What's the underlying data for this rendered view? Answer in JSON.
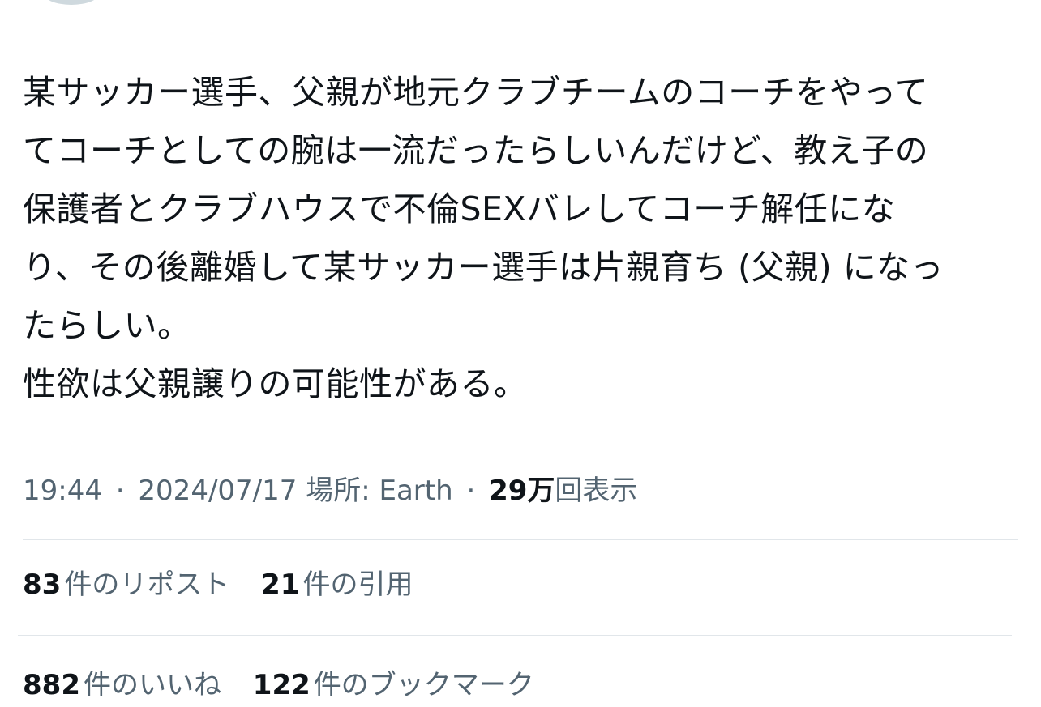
{
  "tweet": {
    "lines": [
      "某サッカー選手、父親が地元クラブチームのコーチをやって",
      "てコーチとしての腕は一流だったらしいんだけど、教え子の",
      "保護者とクラブハウスで不倫SEXバレしてコーチ解任にな",
      "り、その後離婚して某サッカー選手は片親育ち (父親) になっ",
      "たらしい。",
      "性欲は父親譲りの可能性がある。"
    ]
  },
  "meta": {
    "time": "19:44",
    "separator": "·",
    "date": "2024/07/17",
    "location": "場所: Earth",
    "views_count": "29万",
    "views_label": "回表示"
  },
  "stats": {
    "reposts": {
      "count": "83",
      "label": "件のリポスト"
    },
    "quotes": {
      "count": "21",
      "label": "件の引用"
    },
    "likes": {
      "count": "882",
      "label": "件のいいね"
    },
    "bookmarks": {
      "count": "122",
      "label": "件のブックマーク"
    }
  },
  "colors": {
    "text_primary": "#0f1419",
    "text_secondary": "#536471",
    "divider": "#e1e6ea"
  }
}
